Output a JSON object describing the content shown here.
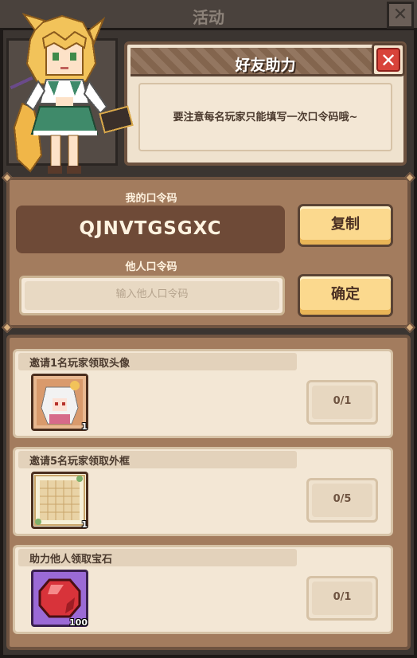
{
  "background": {
    "title": "活动"
  },
  "notice": {
    "title": "好友助力",
    "text": "要注意每名玩家只能填写一次口令码哦~",
    "close_symbol": "✕"
  },
  "code": {
    "my_label": "我的口令码",
    "my_code": "QJNVTGSGXC",
    "copy_label": "复制",
    "other_label": "他人口令码",
    "input_placeholder": "输入他人口令码",
    "confirm_label": "确定"
  },
  "tasks": [
    {
      "label": "邀请1名玩家领取头像",
      "icon": "avatar-icon",
      "quantity": "1",
      "progress": "0/1"
    },
    {
      "label": "邀请5名玩家领取外框",
      "icon": "frame-icon",
      "quantity": "1",
      "progress": "0/5"
    },
    {
      "label": "助力他人领取宝石",
      "icon": "gem-icon",
      "quantity": "100",
      "progress": "0/1"
    }
  ],
  "colors": {
    "panel": "#a37c5e",
    "button": "#fbd98e",
    "close": "#d8433a"
  }
}
